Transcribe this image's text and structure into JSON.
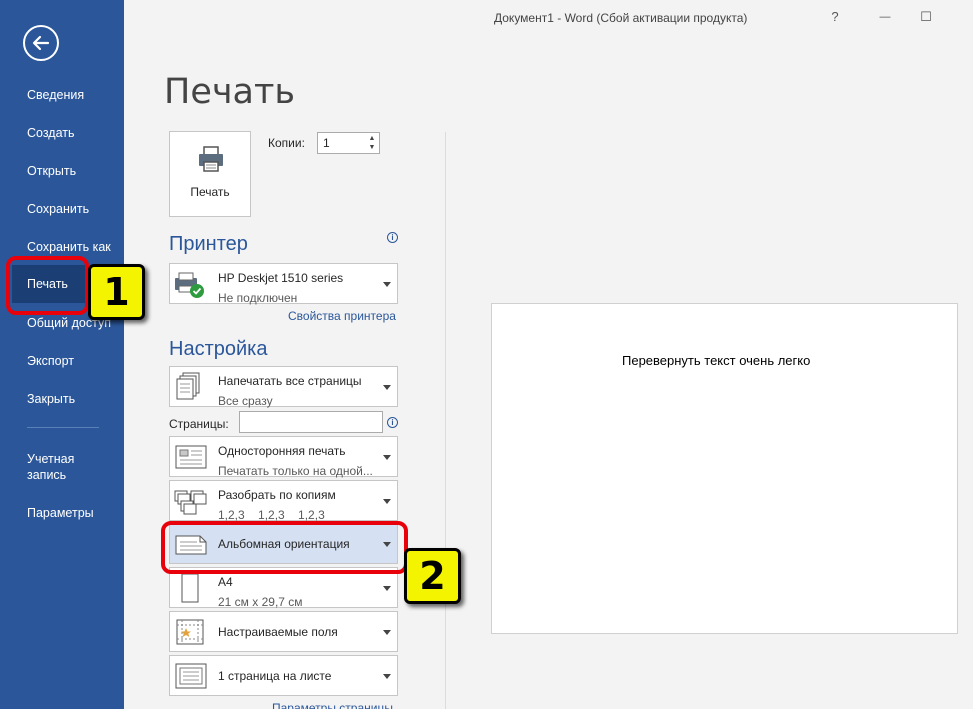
{
  "window": {
    "title": "Документ1 - Word (Сбой активации продукта)",
    "help_glyph": "?",
    "minimize_glyph": "—",
    "restore_glyph": "☐"
  },
  "sidebar": {
    "items": [
      {
        "label": "Сведения"
      },
      {
        "label": "Создать"
      },
      {
        "label": "Открыть"
      },
      {
        "label": "Сохранить"
      },
      {
        "label": "Сохранить как"
      },
      {
        "label": "Печать",
        "active": true
      },
      {
        "label": "Общий доступ"
      },
      {
        "label": "Экспорт"
      },
      {
        "label": "Закрыть"
      }
    ],
    "account_line1": "Учетная",
    "account_line2": "запись",
    "options_label": "Параметры"
  },
  "print": {
    "heading": "Печать",
    "print_button_label": "Печать",
    "copies_label": "Копии:",
    "copies_value": "1"
  },
  "printer": {
    "section_title": "Принтер",
    "name": "HP Deskjet 1510 series",
    "status": "Не подключен",
    "properties_link": "Свойства принтера"
  },
  "settings": {
    "section_title": "Настройка",
    "pages_label": "Страницы:",
    "pages_value": "",
    "options": [
      {
        "title": "Напечатать все страницы",
        "subtitle": "Все сразу"
      },
      {
        "title": "Односторонняя печать",
        "subtitle": "Печатать только на одной..."
      },
      {
        "title": "Разобрать по копиям",
        "subtitle": "1,2,3    1,2,3    1,2,3"
      },
      {
        "title": "Альбомная ориентация",
        "subtitle": ""
      },
      {
        "title": "А4",
        "subtitle": "21 см x 29,7 см"
      },
      {
        "title": "Настраиваемые поля",
        "subtitle": ""
      },
      {
        "title": "1 страница на листе",
        "subtitle": ""
      }
    ],
    "page_setup_link": "Параметры страницы"
  },
  "preview": {
    "text": "Перевернуть текст очень легко"
  },
  "annotations": {
    "badge1": "1",
    "badge2": "2",
    "ring_color": "#e8000b",
    "badge_color": "#f5f400"
  },
  "colors": {
    "sidebar": "#2b579a",
    "sidebar_active": "#1b3f74",
    "accent": "#2b579a",
    "highlight_row": "#d5e1f2"
  }
}
